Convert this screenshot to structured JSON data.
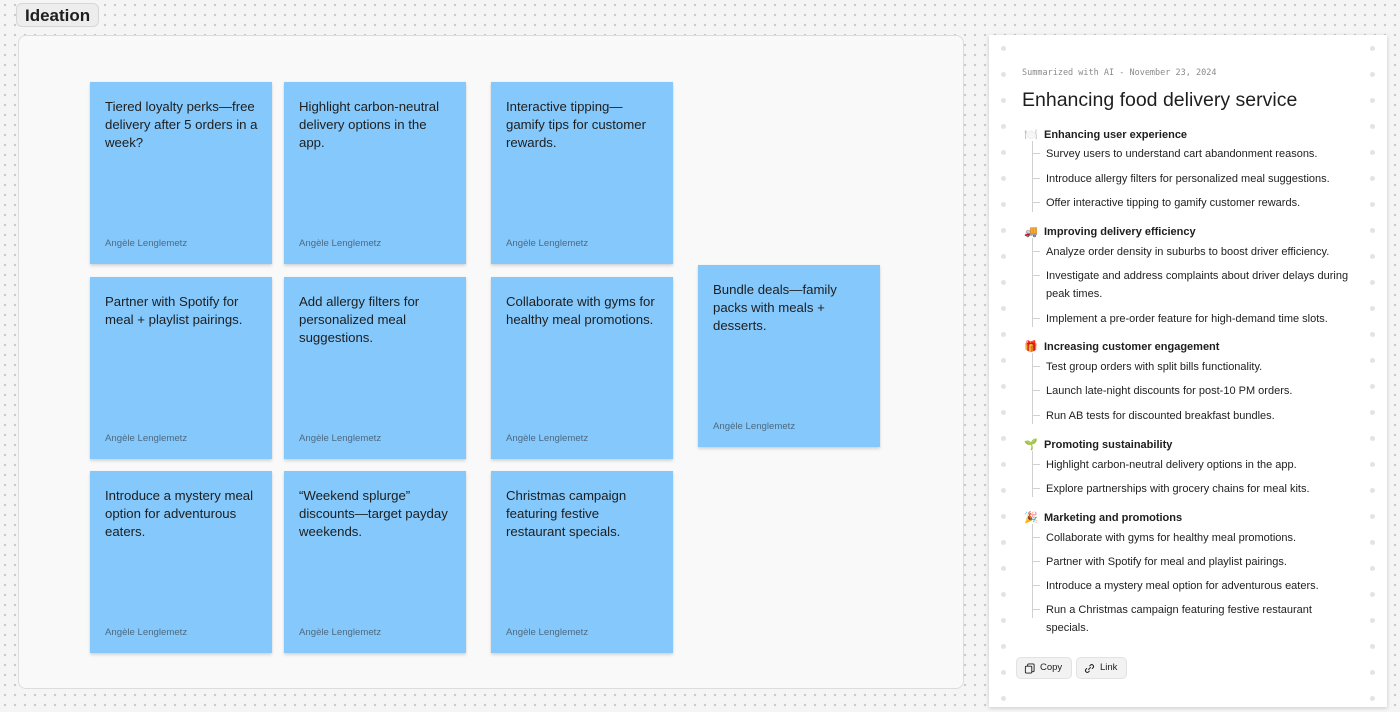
{
  "section": {
    "label": "Ideation"
  },
  "stickies": [
    {
      "text": "Tiered loyalty perks—free delivery after 5 orders in a week?",
      "author": "Angèle Lenglemetz"
    },
    {
      "text": "Highlight carbon-neutral delivery options in the app.",
      "author": "Angèle Lenglemetz"
    },
    {
      "text": "Interactive tipping—gamify tips for customer rewards.",
      "author": "Angèle Lenglemetz"
    },
    {
      "text": "Partner with Spotify for meal + playlist pairings.",
      "author": "Angèle Lenglemetz"
    },
    {
      "text": "Add allergy filters for personalized meal suggestions.",
      "author": "Angèle Lenglemetz"
    },
    {
      "text": "Collaborate with gyms for healthy meal promotions.",
      "author": "Angèle Lenglemetz"
    },
    {
      "text": "Bundle deals—family packs with meals + desserts.",
      "author": "Angèle Lenglemetz"
    },
    {
      "text": "Introduce a mystery meal option for adventurous eaters.",
      "author": "Angèle Lenglemetz"
    },
    {
      "text": "“Weekend splurge” discounts—target payday weekends.",
      "author": "Angèle Lenglemetz"
    },
    {
      "text": "Christmas campaign featuring festive restaurant specials.",
      "author": "Angèle Lenglemetz"
    }
  ],
  "summary": {
    "meta": "Summarized with AI - November 23, 2024",
    "title": "Enhancing food delivery service",
    "topics": [
      {
        "emoji": "🍽️",
        "title": "Enhancing user experience",
        "items": [
          "Survey users to understand cart abandonment reasons.",
          "Introduce allergy filters for personalized meal suggestions.",
          "Offer interactive tipping to gamify customer rewards."
        ]
      },
      {
        "emoji": "🚚",
        "title": "Improving delivery efficiency",
        "items": [
          "Analyze order density in suburbs to boost driver efficiency.",
          "Investigate and address complaints about driver delays during peak times.",
          "Implement a pre-order feature for high-demand time slots."
        ]
      },
      {
        "emoji": "🎁",
        "title": "Increasing customer engagement",
        "items": [
          "Test group orders with split bills functionality.",
          "Launch late-night discounts for post-10 PM orders.",
          "Run AB tests for discounted breakfast bundles."
        ]
      },
      {
        "emoji": "🌱",
        "title": "Promoting sustainability",
        "items": [
          "Highlight carbon-neutral delivery options in the app.",
          "Explore partnerships with grocery chains for meal kits."
        ]
      },
      {
        "emoji": "🎉",
        "title": "Marketing and promotions",
        "items": [
          "Collaborate with gyms for healthy meal promotions.",
          "Partner with Spotify for meal and playlist pairings.",
          "Introduce a mystery meal option for adventurous eaters.",
          "Run a Christmas campaign featuring festive restaurant specials."
        ]
      }
    ],
    "actions": {
      "copy": "Copy",
      "link": "Link"
    }
  },
  "colors": {
    "sticky": "#84c8fc",
    "canvas": "#f5f5f5",
    "section_fill": "#f9f9f9"
  },
  "icons": {
    "copy": "copy-icon",
    "link": "link-icon"
  }
}
